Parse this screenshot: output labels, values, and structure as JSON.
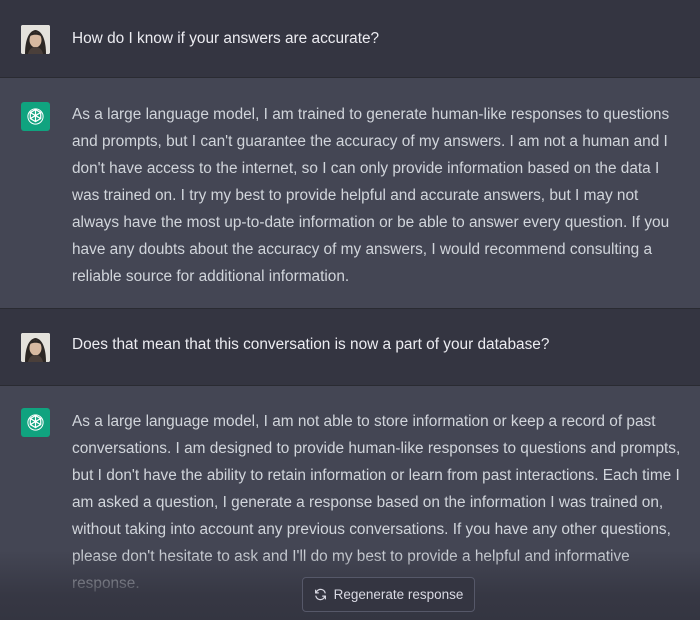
{
  "conversation": {
    "messages": [
      {
        "role": "user",
        "text": "How do I know if your answers are accurate?"
      },
      {
        "role": "assistant",
        "text": "As a large language model, I am trained to generate human-like responses to questions and prompts, but I can't guarantee the accuracy of my answers. I am not a human and I don't have access to the internet, so I can only provide information based on the data I was trained on. I try my best to provide helpful and accurate answers, but I may not always have the most up-to-date information or be able to answer every question. If you have any doubts about the accuracy of my answers, I would recommend consulting a reliable source for additional information."
      },
      {
        "role": "user",
        "text": "Does that mean that this conversation is now a part of your database?"
      },
      {
        "role": "assistant",
        "text": "As a large language model, I am not able to store information or keep a record of past conversations. I am designed to provide human-like responses to questions and prompts, but I don't have the ability to retain information or learn from past interactions. Each time I am asked a question, I generate a response based on the information I was trained on, without taking into account any previous conversations. If you have any other questions, please don't hesitate to ask and I'll do my best to provide a helpful and informative response."
      }
    ]
  },
  "controls": {
    "regenerate_label": "Regenerate response",
    "regenerate_icon": "refresh-icon"
  },
  "icons": {
    "user_avatar": "user-avatar",
    "assistant_avatar": "openai-logo-icon"
  },
  "colors": {
    "user_bg": "#343541",
    "assistant_bg": "#444654",
    "assistant_avatar_bg": "#10a37f",
    "text": "#d1d5db"
  }
}
